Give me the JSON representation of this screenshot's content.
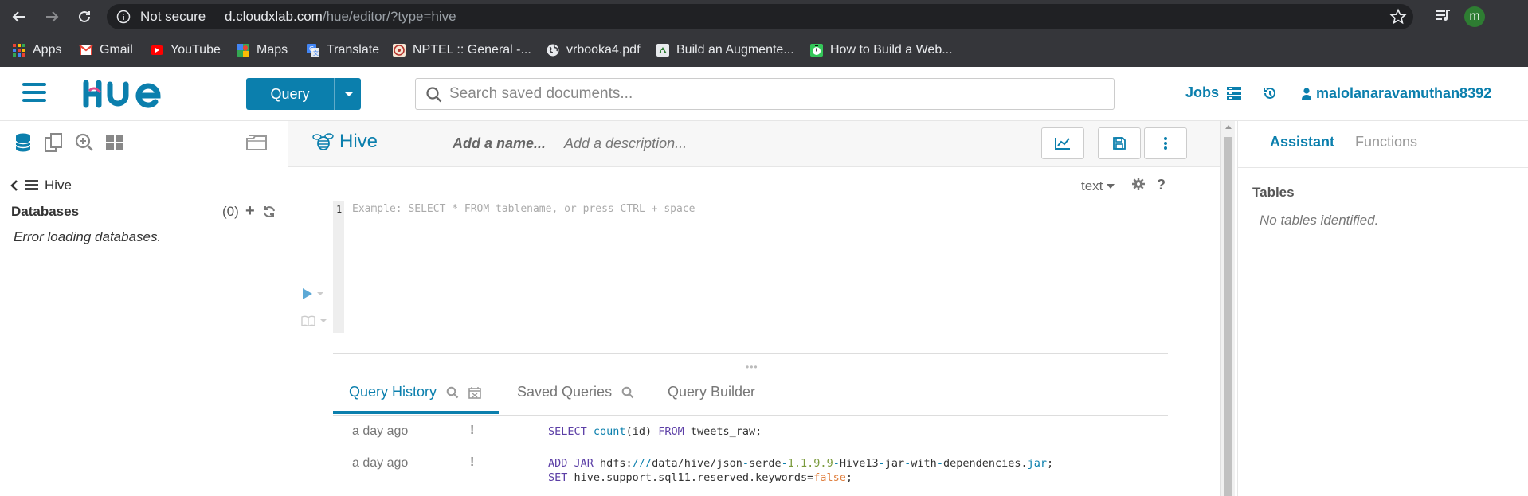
{
  "browser": {
    "not_secure": "Not secure",
    "url_host": "d.cloudxlab.com",
    "url_path": "/hue/editor/?type=hive",
    "profile_initial": "m",
    "bookmarks": [
      {
        "label": "Apps",
        "icon": "apps-grid-icon"
      },
      {
        "label": "Gmail",
        "icon": "gmail-icon"
      },
      {
        "label": "YouTube",
        "icon": "youtube-icon"
      },
      {
        "label": "Maps",
        "icon": "maps-icon"
      },
      {
        "label": "Translate",
        "icon": "translate-icon"
      },
      {
        "label": "NPTEL :: General -...",
        "icon": "nptel-icon"
      },
      {
        "label": "vrbooka4.pdf",
        "icon": "globe-icon"
      },
      {
        "label": "Build an Augmente...",
        "icon": "site-icon"
      },
      {
        "label": "How to Build a Web...",
        "icon": "timer-icon"
      }
    ]
  },
  "hue": {
    "logo": "HUE",
    "query_button": "Query",
    "search_placeholder": "Search saved documents...",
    "jobs_label": "Jobs",
    "username": "malolanaravamuthan8392"
  },
  "left_panel": {
    "back_label": "Hive",
    "databases_title": "Databases",
    "databases_count": "(0)",
    "error": "Error loading databases."
  },
  "editor": {
    "type_title": "Hive",
    "name_placeholder": "Add a name...",
    "description_placeholder": "Add a description...",
    "mode": "text",
    "help": "?",
    "line_number": "1",
    "code_placeholder": "Example: SELECT * FROM tablename, or press CTRL + space",
    "tabs": [
      {
        "label": "Query History",
        "active": true
      },
      {
        "label": "Saved Queries",
        "active": false
      },
      {
        "label": "Query Builder",
        "active": false
      }
    ],
    "history": [
      {
        "when": "a day ago",
        "status": "!",
        "lines": [
          "SELECT count(id) FROM tweets_raw;"
        ]
      },
      {
        "when": "a day ago",
        "status": "!",
        "lines": [
          "ADD JAR hdfs:///data/hive/json-serde-1.1.9.9-Hive13-jar-with-dependencies.jar;",
          "SET hive.support.sql11.reserved.keywords=false;"
        ]
      }
    ]
  },
  "right_panel": {
    "tabs": [
      {
        "label": "Assistant",
        "active": true
      },
      {
        "label": "Functions",
        "active": false
      }
    ],
    "tables_title": "Tables",
    "empty_text": "No tables identified."
  },
  "colors": {
    "accent": "#0B7FAD",
    "chrome_bg": "#35363a",
    "omnibox_bg": "#202124"
  }
}
